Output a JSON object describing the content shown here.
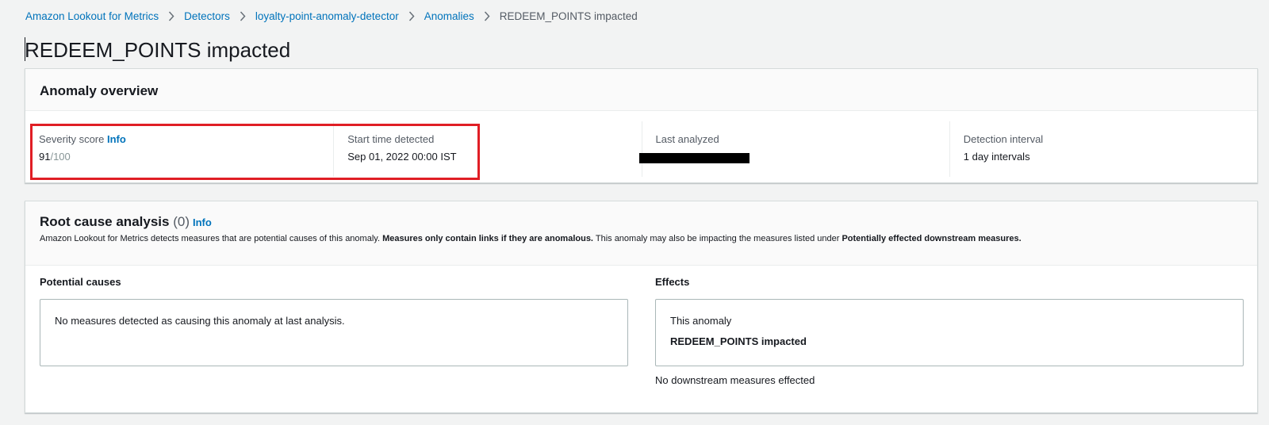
{
  "breadcrumb": {
    "items": [
      "Amazon Lookout for Metrics",
      "Detectors",
      "loyalty-point-anomaly-detector",
      "Anomalies"
    ],
    "current": "REDEEM_POINTS impacted"
  },
  "page": {
    "title": "REDEEM_POINTS impacted"
  },
  "overview": {
    "title": "Anomaly overview",
    "severity": {
      "label": "Severity score",
      "info": "Info",
      "score": "91",
      "max": "/100"
    },
    "start_time": {
      "label": "Start time detected",
      "value": "Sep 01, 2022 00:00 IST"
    },
    "last_analyzed": {
      "label": "Last analyzed"
    },
    "interval": {
      "label": "Detection interval",
      "value": "1 day intervals"
    }
  },
  "rca": {
    "title": "Root cause analysis",
    "count": "(0)",
    "info": "Info",
    "desc_a": "Amazon Lookout for Metrics detects measures that are potential causes of this anomaly. ",
    "desc_b": "Measures only contain links if they are anomalous.",
    "desc_c": " This anomaly may also be impacting the measures listed under ",
    "desc_d": "Potentially effected downstream measures.",
    "causes": {
      "title": "Potential causes",
      "empty": "No measures detected as causing this anomaly at last analysis."
    },
    "effects": {
      "title": "Effects",
      "label": "This anomaly",
      "value": "REDEEM_POINTS impacted",
      "downstream": "No downstream measures effected"
    }
  },
  "colors": {
    "link": "#0073bb",
    "highlight": "#e01e25",
    "text": "#16191f",
    "muted": "#545b64",
    "background": "#f2f3f3"
  },
  "icons": {
    "separator": "chevron-right-icon",
    "flow": "arrow-right-icon"
  }
}
